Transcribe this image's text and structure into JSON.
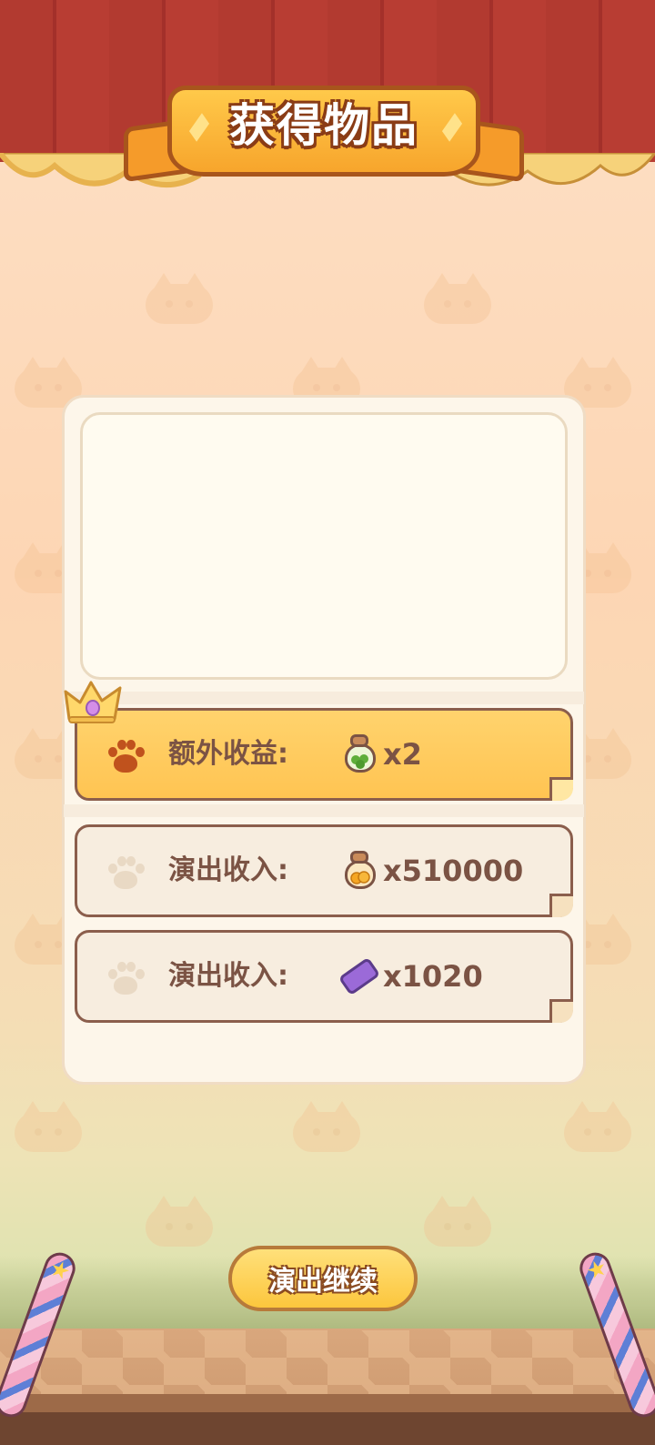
{
  "title": "获得物品",
  "rewards": [
    {
      "label": "额外收益:",
      "value": "x2",
      "icon": "clover-bag-icon",
      "highlighted": true
    },
    {
      "label": "演出收入:",
      "value": "x510000",
      "icon": "coin-bag-icon",
      "highlighted": false
    },
    {
      "label": "演出收入:",
      "value": "x1020",
      "icon": "ticket-icon",
      "highlighted": false
    }
  ],
  "continue_button": "演出继续",
  "colors": {
    "curtain": "#b23a30",
    "banner": "#f7a52c",
    "highlight_row": "#ffc452",
    "text_brown": "#7b5344",
    "paw_active": "#c0521d",
    "paw_inactive": "#e9d9c4"
  }
}
